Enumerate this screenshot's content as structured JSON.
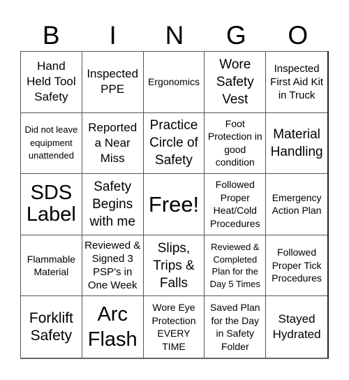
{
  "header": {
    "letters": [
      "B",
      "I",
      "N",
      "G",
      "O"
    ]
  },
  "board": {
    "cells": [
      "Hand Held Tool Safety",
      "Inspected PPE",
      "Ergonomics",
      "Wore Safety Vest",
      "Inspected First Aid Kit in Truck",
      "Did not leave equipment unattended",
      "Reported a Near Miss",
      "Practice Circle of Safety",
      "Foot Protection in good condition",
      "Material Handling",
      "SDS Label",
      "Safety Begins with me",
      "Free!",
      "Followed Proper Heat/Cold Procedures",
      "Emergency Action Plan",
      "Flammable Material",
      "Reviewed & Signed 3 PSP's in One Week",
      "Slips, Trips & Falls",
      "Reviewed & Completed Plan for the Day 5 Times",
      "Followed Proper Tick Procedures",
      "Forklift Safety",
      "Arc Flash",
      "Wore Eye Protection EVERY TIME",
      "Saved Plan for the Day in Safety Folder",
      "Stayed Hydrated"
    ],
    "free_space_index": 12
  }
}
